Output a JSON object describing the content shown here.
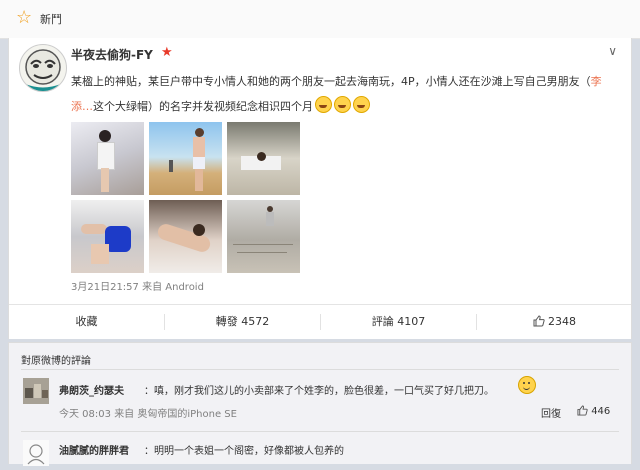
{
  "topbar": {
    "title": "新鬥"
  },
  "post": {
    "author": "半夜去偷狗-FY",
    "text_part1": "某楹上的神贴，某巨户带中专小情人和她的两个朋友一起去海南玩，4P，小情人还在沙滩上写自己男朋友（",
    "link_text": "李添…",
    "text_part2": "这个大绿帽）的名字并发视频纪念相识四个月",
    "time": "3月21日21:57",
    "source": "来自 Android"
  },
  "actions": {
    "fav_label": "收藏",
    "repost_label": "轉發",
    "repost_count": "4572",
    "comment_label": "評論",
    "comment_count": "4107",
    "like_count": "2348"
  },
  "comments": {
    "header": "對原微博的評論",
    "items": [
      {
        "name": "弗朗茨_约瑟夫",
        "text": "：嗔，刚才我们这儿的小卖部来了个姓李的，脸色很差，一口气买了好几把刀。",
        "time": "今天 08:03",
        "source": "来自 奥匈帝国的iPhone SE",
        "reply": "回復",
        "likes": "446"
      },
      {
        "name": "油腻腻的胖胖君",
        "text": "：明明一个表姐一个阁密，好像都被人包养的"
      }
    ]
  }
}
